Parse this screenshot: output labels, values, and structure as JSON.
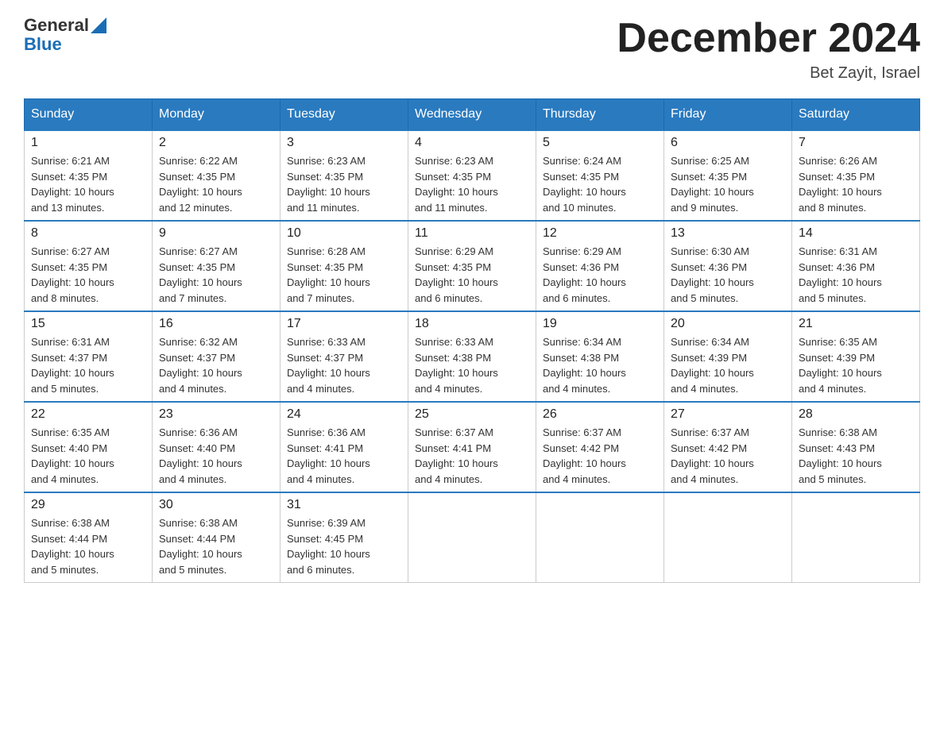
{
  "logo": {
    "general": "General",
    "blue": "Blue",
    "triangle": "▶"
  },
  "title": "December 2024",
  "location": "Bet Zayit, Israel",
  "headers": [
    "Sunday",
    "Monday",
    "Tuesday",
    "Wednesday",
    "Thursday",
    "Friday",
    "Saturday"
  ],
  "weeks": [
    [
      {
        "day": "1",
        "info": "Sunrise: 6:21 AM\nSunset: 4:35 PM\nDaylight: 10 hours\nand 13 minutes."
      },
      {
        "day": "2",
        "info": "Sunrise: 6:22 AM\nSunset: 4:35 PM\nDaylight: 10 hours\nand 12 minutes."
      },
      {
        "day": "3",
        "info": "Sunrise: 6:23 AM\nSunset: 4:35 PM\nDaylight: 10 hours\nand 11 minutes."
      },
      {
        "day": "4",
        "info": "Sunrise: 6:23 AM\nSunset: 4:35 PM\nDaylight: 10 hours\nand 11 minutes."
      },
      {
        "day": "5",
        "info": "Sunrise: 6:24 AM\nSunset: 4:35 PM\nDaylight: 10 hours\nand 10 minutes."
      },
      {
        "day": "6",
        "info": "Sunrise: 6:25 AM\nSunset: 4:35 PM\nDaylight: 10 hours\nand 9 minutes."
      },
      {
        "day": "7",
        "info": "Sunrise: 6:26 AM\nSunset: 4:35 PM\nDaylight: 10 hours\nand 8 minutes."
      }
    ],
    [
      {
        "day": "8",
        "info": "Sunrise: 6:27 AM\nSunset: 4:35 PM\nDaylight: 10 hours\nand 8 minutes."
      },
      {
        "day": "9",
        "info": "Sunrise: 6:27 AM\nSunset: 4:35 PM\nDaylight: 10 hours\nand 7 minutes."
      },
      {
        "day": "10",
        "info": "Sunrise: 6:28 AM\nSunset: 4:35 PM\nDaylight: 10 hours\nand 7 minutes."
      },
      {
        "day": "11",
        "info": "Sunrise: 6:29 AM\nSunset: 4:35 PM\nDaylight: 10 hours\nand 6 minutes."
      },
      {
        "day": "12",
        "info": "Sunrise: 6:29 AM\nSunset: 4:36 PM\nDaylight: 10 hours\nand 6 minutes."
      },
      {
        "day": "13",
        "info": "Sunrise: 6:30 AM\nSunset: 4:36 PM\nDaylight: 10 hours\nand 5 minutes."
      },
      {
        "day": "14",
        "info": "Sunrise: 6:31 AM\nSunset: 4:36 PM\nDaylight: 10 hours\nand 5 minutes."
      }
    ],
    [
      {
        "day": "15",
        "info": "Sunrise: 6:31 AM\nSunset: 4:37 PM\nDaylight: 10 hours\nand 5 minutes."
      },
      {
        "day": "16",
        "info": "Sunrise: 6:32 AM\nSunset: 4:37 PM\nDaylight: 10 hours\nand 4 minutes."
      },
      {
        "day": "17",
        "info": "Sunrise: 6:33 AM\nSunset: 4:37 PM\nDaylight: 10 hours\nand 4 minutes."
      },
      {
        "day": "18",
        "info": "Sunrise: 6:33 AM\nSunset: 4:38 PM\nDaylight: 10 hours\nand 4 minutes."
      },
      {
        "day": "19",
        "info": "Sunrise: 6:34 AM\nSunset: 4:38 PM\nDaylight: 10 hours\nand 4 minutes."
      },
      {
        "day": "20",
        "info": "Sunrise: 6:34 AM\nSunset: 4:39 PM\nDaylight: 10 hours\nand 4 minutes."
      },
      {
        "day": "21",
        "info": "Sunrise: 6:35 AM\nSunset: 4:39 PM\nDaylight: 10 hours\nand 4 minutes."
      }
    ],
    [
      {
        "day": "22",
        "info": "Sunrise: 6:35 AM\nSunset: 4:40 PM\nDaylight: 10 hours\nand 4 minutes."
      },
      {
        "day": "23",
        "info": "Sunrise: 6:36 AM\nSunset: 4:40 PM\nDaylight: 10 hours\nand 4 minutes."
      },
      {
        "day": "24",
        "info": "Sunrise: 6:36 AM\nSunset: 4:41 PM\nDaylight: 10 hours\nand 4 minutes."
      },
      {
        "day": "25",
        "info": "Sunrise: 6:37 AM\nSunset: 4:41 PM\nDaylight: 10 hours\nand 4 minutes."
      },
      {
        "day": "26",
        "info": "Sunrise: 6:37 AM\nSunset: 4:42 PM\nDaylight: 10 hours\nand 4 minutes."
      },
      {
        "day": "27",
        "info": "Sunrise: 6:37 AM\nSunset: 4:42 PM\nDaylight: 10 hours\nand 4 minutes."
      },
      {
        "day": "28",
        "info": "Sunrise: 6:38 AM\nSunset: 4:43 PM\nDaylight: 10 hours\nand 5 minutes."
      }
    ],
    [
      {
        "day": "29",
        "info": "Sunrise: 6:38 AM\nSunset: 4:44 PM\nDaylight: 10 hours\nand 5 minutes."
      },
      {
        "day": "30",
        "info": "Sunrise: 6:38 AM\nSunset: 4:44 PM\nDaylight: 10 hours\nand 5 minutes."
      },
      {
        "day": "31",
        "info": "Sunrise: 6:39 AM\nSunset: 4:45 PM\nDaylight: 10 hours\nand 6 minutes."
      },
      {
        "day": "",
        "info": ""
      },
      {
        "day": "",
        "info": ""
      },
      {
        "day": "",
        "info": ""
      },
      {
        "day": "",
        "info": ""
      }
    ]
  ]
}
